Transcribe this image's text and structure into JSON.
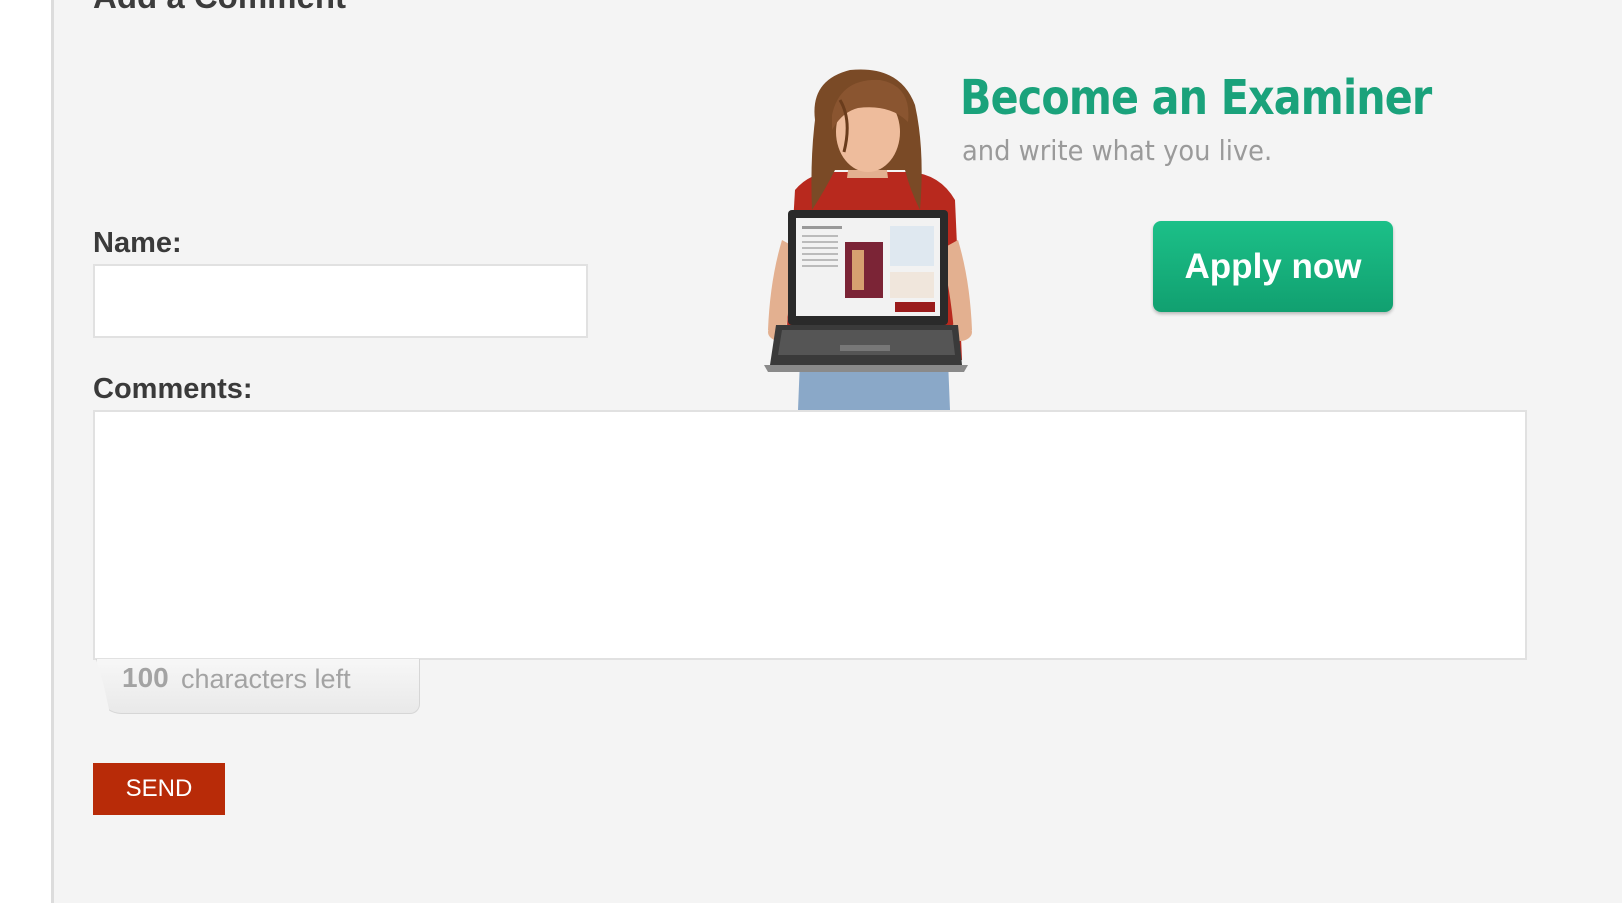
{
  "form": {
    "heading": "Add a Comment",
    "name_label": "Name:",
    "name_value": "",
    "comments_label": "Comments:",
    "comments_value": "",
    "counter": {
      "count": "100",
      "text": "characters left"
    },
    "send_label": "SEND"
  },
  "ad": {
    "headline": "Become an Examiner",
    "subline": "and write what you live.",
    "apply_label": "Apply now",
    "brand_color": "#1aa27b",
    "image": "woman-holding-laptop-illustration"
  },
  "colors": {
    "send_button": "#b82b08",
    "panel_background": "#f4f4f4"
  }
}
